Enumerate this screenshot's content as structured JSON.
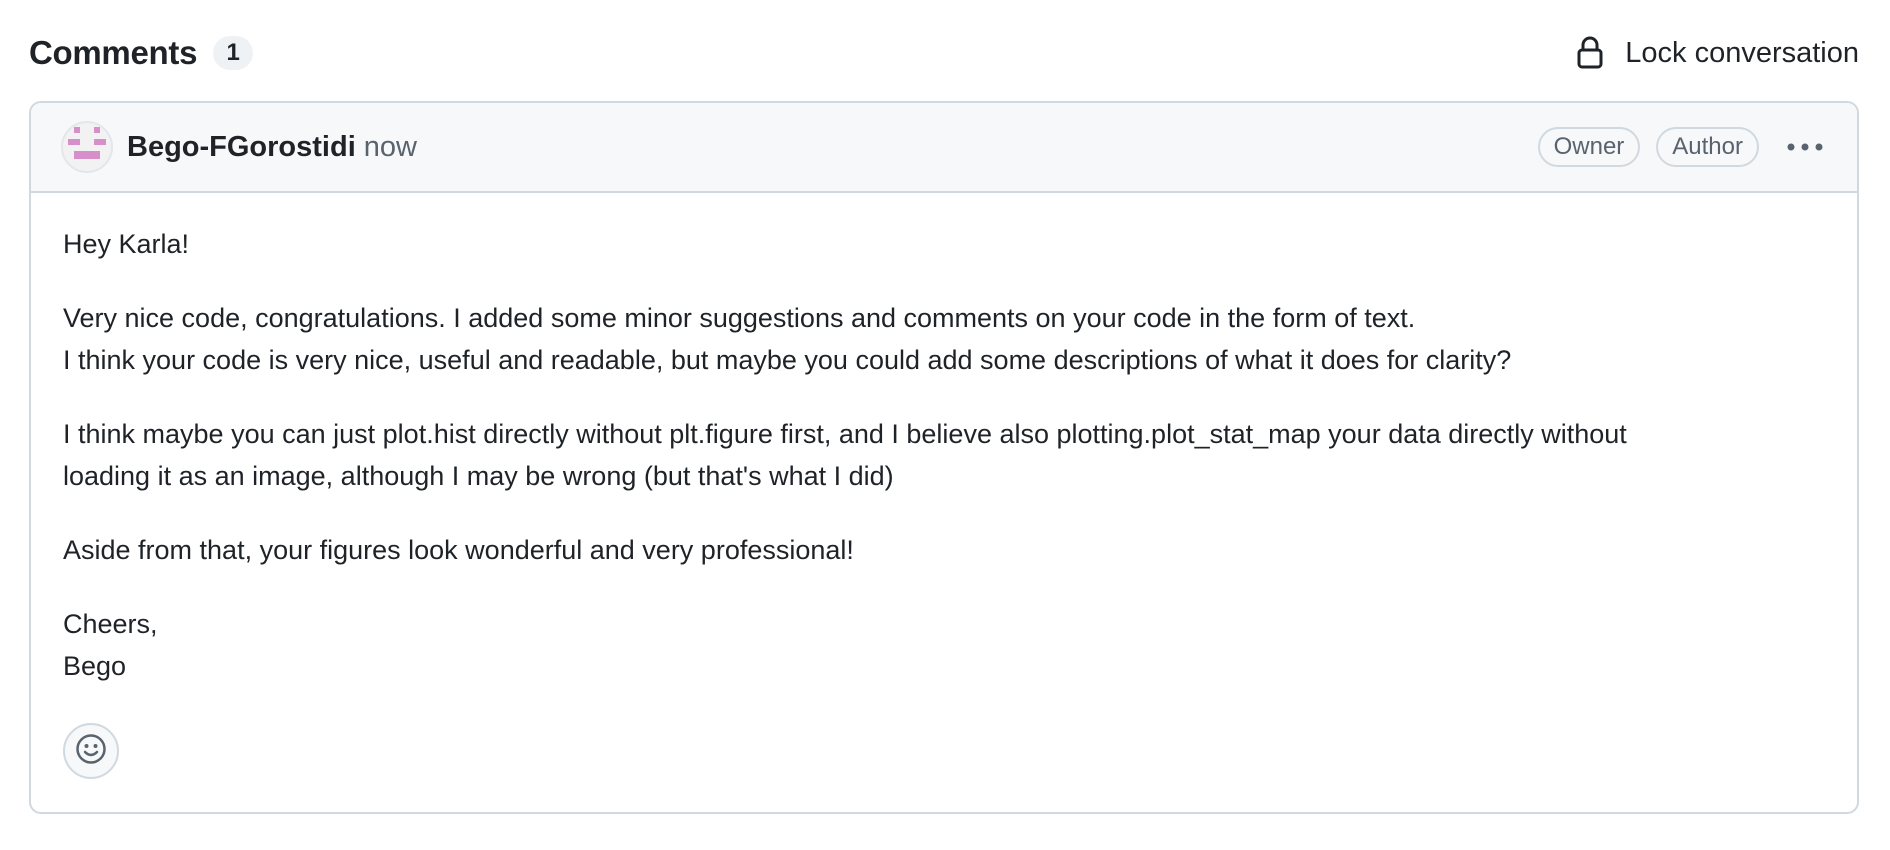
{
  "header": {
    "title": "Comments",
    "count": "1",
    "lock_label": "Lock conversation",
    "lock_icon": "lock-icon"
  },
  "comment": {
    "author": "Bego-FGorostidi",
    "timestamp": "now",
    "badges": {
      "owner": "Owner",
      "author": "Author"
    },
    "more_icon": "kebab-horizontal-icon",
    "avatar_color": "#d68fc9",
    "body": {
      "p1": "Hey Karla!",
      "p2_line1": "Very nice code, congratulations. I added some minor suggestions and comments on your code in the form of text.",
      "p2_line2": "I think your code is very nice, useful and readable, but maybe you could add some descriptions of what it does for clarity?",
      "p3_line1": "I think maybe you can just plot.hist directly without plt.figure first, and I believe also plotting.plot_stat_map your data directly without",
      "p3_line2": "loading it as an image, although I may be wrong (but that's what I did)",
      "p4": "Aside from that, your figures look wonderful and very professional!",
      "p5_line1": "Cheers,",
      "p5_line2": "Bego"
    },
    "reaction_icon": "smiley-icon"
  },
  "colors": {
    "text": "#1f2328",
    "muted": "#59636e",
    "border": "#d1d9e0",
    "header_bg": "#f6f8fa"
  }
}
